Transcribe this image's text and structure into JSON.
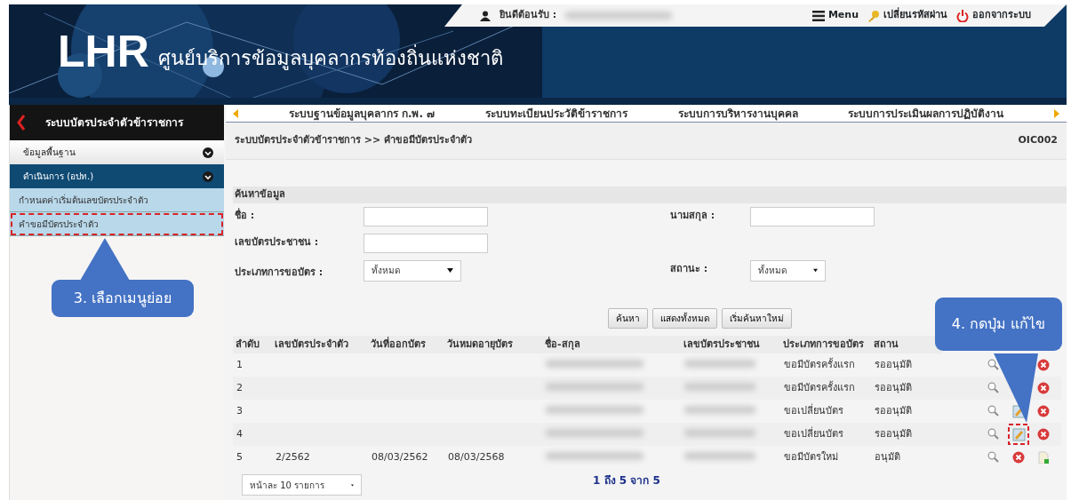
{
  "header": {
    "welcome_label": "ยินดีต้อนรับ :",
    "user_name_redacted": true,
    "menu_label": "Menu",
    "change_password": "เปลี่ยนรหัสผ่าน",
    "logout": "ออกจากระบบ",
    "logo_text": "LHR",
    "site_title": "ศูนย์บริการข้อมูลบุคลากรท้องถิ่นแห่งชาติ"
  },
  "sidebar": {
    "title": "ระบบบัตรประจำตัวข้าราชการ",
    "groups": [
      {
        "label": "ข้อมูลพื้นฐาน",
        "expanded": false
      },
      {
        "label": "ดำเนินการ (อปท.)",
        "expanded": true,
        "children": [
          {
            "label": "กำหนดค่าเริ่มต้นเลขบัตรประจำตัว",
            "highlighted": false
          },
          {
            "label": "คำขอมีบัตรประจำตัว",
            "highlighted": true
          }
        ]
      }
    ]
  },
  "system_links": [
    {
      "label": "ระบบฐานข้อมูลบุคลากร ก.พ. ๗"
    },
    {
      "label": "ระบบทะเบียนประวัติข้าราชการ"
    },
    {
      "label": "ระบบการบริหารงานบุคคล"
    },
    {
      "label": "ระบบการประเมินผลการปฏิบัติงาน"
    }
  ],
  "breadcrumb": "ระบบบัตรประจำตัวข้าราชการ >>  คำขอมีบัตรประจำตัว",
  "page_code": "OIC002",
  "search": {
    "title": "ค้นหาข้อมูล",
    "fields": [
      {
        "label": "ชื่อ :",
        "kind": "text"
      },
      {
        "label": "นามสกุล :",
        "kind": "text"
      },
      {
        "label": "เลขบัตรประชาชน :",
        "kind": "text"
      },
      {
        "label": "ประเภทการขอบัตร :",
        "kind": "select",
        "value": "ทั้งหมด"
      },
      {
        "label": "สถานะ :",
        "kind": "select",
        "value": "ทั้งหมด"
      }
    ],
    "buttons": [
      "ค้นหา",
      "แสดงทั้งหมด",
      "เริ่มค้นหาใหม่"
    ]
  },
  "table": {
    "columns": [
      "ลำดับ",
      "เลขบัตรประจำตัว",
      "วันที่ออกบัตร",
      "วันหมดอายุบัตร",
      "ชื่อ-สกุล",
      "เลขบัตรประชาชน",
      "ประเภทการขอบัตร",
      "สถาน"
    ],
    "rows": [
      {
        "no": "1",
        "card_no": "",
        "issued": "",
        "expires": "",
        "name_redacted": true,
        "citizen_id_redacted": true,
        "request_type": "ขอมีบัตรครั้งแรก",
        "status": "รออนุมัติ",
        "actions": [
          {
            "kind": "view"
          },
          {
            "kind": "blank"
          },
          {
            "kind": "delete"
          }
        ]
      },
      {
        "no": "2",
        "card_no": "",
        "issued": "",
        "expires": "",
        "name_redacted": true,
        "citizen_id_redacted": true,
        "request_type": "ขอมีบัตรครั้งแรก",
        "status": "รออนุมัติ",
        "actions": [
          {
            "kind": "view"
          },
          {
            "kind": "blank"
          },
          {
            "kind": "delete"
          }
        ]
      },
      {
        "no": "3",
        "card_no": "",
        "issued": "",
        "expires": "",
        "name_redacted": true,
        "citizen_id_redacted": true,
        "request_type": "ขอเปลี่ยนบัตร",
        "status": "รออนุมัติ",
        "actions": [
          {
            "kind": "view"
          },
          {
            "kind": "edit",
            "highlighted": false
          },
          {
            "kind": "delete"
          }
        ]
      },
      {
        "no": "4",
        "card_no": "",
        "issued": "",
        "expires": "",
        "name_redacted": true,
        "citizen_id_redacted": true,
        "request_type": "ขอเปลี่ยนบัตร",
        "status": "รออนุมัติ",
        "actions": [
          {
            "kind": "view"
          },
          {
            "kind": "edit",
            "highlighted": true
          },
          {
            "kind": "delete"
          }
        ]
      },
      {
        "no": "5",
        "card_no": "2/2562",
        "issued": "08/03/2562",
        "expires": "08/03/2568",
        "name_redacted": true,
        "citizen_id_redacted": true,
        "request_type": "ขอมีบัตรใหม่",
        "status": "อนุมัติ",
        "actions": [
          {
            "kind": "view"
          },
          {
            "kind": "delete"
          },
          {
            "kind": "document"
          }
        ]
      }
    ]
  },
  "page_size": "หน้าละ 10 รายการ",
  "pagination": "1 ถึง 5 จาก 5",
  "callouts": [
    {
      "text": "3. เลือกเมนูย่อย"
    },
    {
      "text": "4. กดปุ่ม แก้ไข"
    }
  ]
}
